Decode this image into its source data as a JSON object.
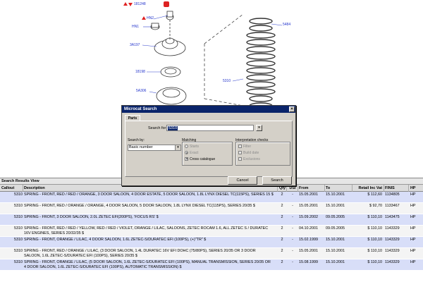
{
  "diagram": {
    "top_code": "181248",
    "callouts": [
      "HN2",
      "HN1",
      "3A197",
      "18198",
      "5A306",
      "5310",
      "5484"
    ]
  },
  "dialog": {
    "title": "Microcat Search",
    "close_glyph": "×",
    "tab_label": "Parts",
    "search_for_label": "Search for",
    "search_value": "5310",
    "search_by_label": "Search by:",
    "search_by_value": "Basic number",
    "matching_label": "Matching",
    "matching_options": [
      {
        "label": "Starts",
        "selected": false,
        "enabled": false
      },
      {
        "label": "Exact",
        "selected": true,
        "enabled": false
      },
      {
        "label": "Cross catalogue",
        "selected": false,
        "checked": true,
        "enabled": true
      }
    ],
    "interp_label": "Interpretation checks",
    "interp_options": [
      {
        "label": "Filter",
        "checked": false
      },
      {
        "label": "Build date",
        "checked": false
      },
      {
        "label": "Exclusions",
        "checked": false
      }
    ],
    "cancel_label": "Cancel",
    "search_label": "Search"
  },
  "results": {
    "title": "Search Results View",
    "columns": [
      "Callout",
      "Description",
      "Qty",
      "DSI",
      "From",
      "To",
      "Retail Inc Vat",
      "FINIS",
      "HP"
    ],
    "rows": [
      {
        "callout": "5310",
        "desc": "SPRING - FRONT, RED / RED / ORANGE, 3 DOOR SALOON, 4 DOOR ESTATE, 5 DOOR SALOON, 1.8L LYNX DIESEL TC(115PS), SERIES 15 $",
        "qty": "2",
        "dsi": "-",
        "from": "15.05.2001",
        "to": "15.10.2001",
        "price": "$ 112,60",
        "finis": "1134805",
        "hp": "HP",
        "lines": 2
      },
      {
        "callout": "5310",
        "desc": "SPRING - FRONT, RED / ORANGE / ORANGE, 4 DOOR SALOON, 5 DOOR SALOON, 1.8L LYNX DIESEL TC(115PS), SERIES 20/35 $",
        "qty": "2",
        "dsi": "-",
        "from": "15.05.2001",
        "to": "15.10.2001",
        "price": "$ 92,70",
        "finis": "1133467",
        "hp": "HP",
        "lines": 2
      },
      {
        "callout": "5310",
        "desc": "SPRING - FRONT, 3 DOOR SALOON, 2.0L ZETEC EFI(200PS), 'FOCUS RS' $",
        "qty": "2",
        "dsi": "-",
        "from": "15.09.2002",
        "to": "09.05.2005",
        "price": "$ 110,10",
        "finis": "1143475",
        "hp": "HP",
        "lines": 2
      },
      {
        "callout": "5310",
        "desc": "SPRING - FRONT, RED / RED / YELLOW, RED / RED / VIOLET, ORANGE / LILAC, SALOONS, ZETEC ROCAM 1.6, ALL ZETEC S / DURATEC 16V ENGINES, SERIES 20/32/35 $",
        "qty": "2",
        "dsi": "-",
        "from": "04.10.2001",
        "to": "09.05.2005",
        "price": "$ 110,10",
        "finis": "1143329",
        "hp": "HP",
        "lines": 2
      },
      {
        "callout": "5310",
        "desc": "SPRING - FRONT, ORANGE / LILAC, 4 DOOR SALOON, 1.6L ZETEC-S/DURATEC EFI (100PS), (+)\"TR\" $",
        "qty": "2",
        "dsi": "-",
        "from": "15.02.1999",
        "to": "15.10.2001",
        "price": "$ 110,10",
        "finis": "1143329",
        "hp": "HP",
        "lines": 2
      },
      {
        "callout": "5310",
        "desc": "SPRING - FRONT, RED / ORANGE / LILAC, (3 DOOR SALOON, 1.4L DURATEC 16V EFI DOHC (75/80PS), SERIES 20/35 OR 3 DOOR SALOON, 1.6L ZETEC-S/DURATEC EFI (100PS), SERIES 20/35 $",
        "qty": "2",
        "dsi": "-",
        "from": "15.05.2001",
        "to": "15.10.2001",
        "price": "$ 110,10",
        "finis": "1143329",
        "hp": "HP",
        "lines": 2
      },
      {
        "callout": "5310",
        "desc": "SPRING - FRONT, ORANGE / LILAC, (5 DOOR SALOON, 1.6L ZETEC-S/DURATEC EFI (100PS), MANUAL TRANSMISSION, SERIES 20/35 OR 4 DOOR SALOON, 1.6L ZETEC-S/DURATEC EFI (100PS), AUTOMATIC TRANSMISSION) $",
        "qty": "2",
        "dsi": "-",
        "from": "15.08.1999",
        "to": "15.10.2001",
        "price": "$ 110,10",
        "finis": "1143329",
        "hp": "HP",
        "lines": 2
      }
    ]
  }
}
